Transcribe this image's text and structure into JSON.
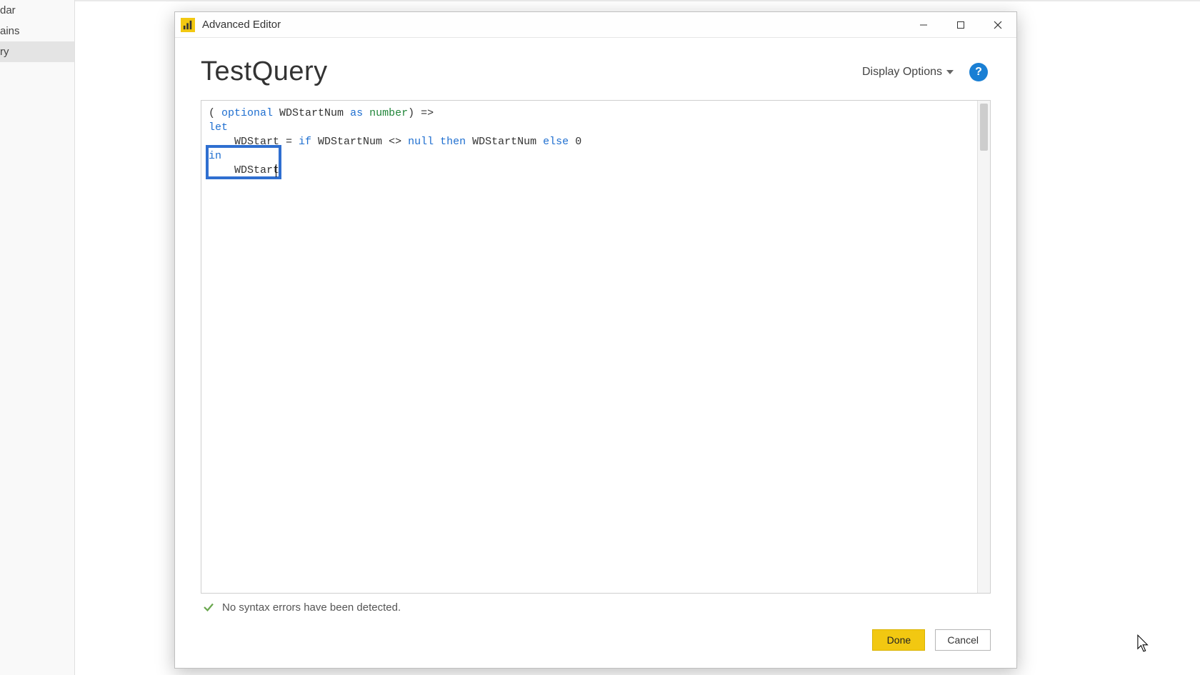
{
  "sidebar": {
    "items": [
      "dar",
      "ains",
      "ry"
    ]
  },
  "window": {
    "title": "Advanced Editor"
  },
  "header": {
    "query_name": "TestQuery",
    "display_options_label": "Display Options"
  },
  "code": {
    "line1_open": "( ",
    "line1_kw_optional": "optional",
    "line1_mid": " WDStartNum ",
    "line1_kw_as": "as",
    "line1_space": " ",
    "line1_type": "number",
    "line1_close": ") =>",
    "line2_kw_let": "let",
    "line3_indent": "    WDStart = ",
    "line3_kw_if": "if",
    "line3_mid1": " WDStartNum <> ",
    "line3_kw_null": "null",
    "line3_space1": " ",
    "line3_kw_then": "then",
    "line3_mid2": " WDStartNum ",
    "line3_kw_else": "else",
    "line3_space2": " ",
    "line3_num": "0",
    "line4_kw_in": "in",
    "line5_indent": "    WDStart"
  },
  "status": {
    "message": "No syntax errors have been detected."
  },
  "buttons": {
    "done": "Done",
    "cancel": "Cancel"
  }
}
